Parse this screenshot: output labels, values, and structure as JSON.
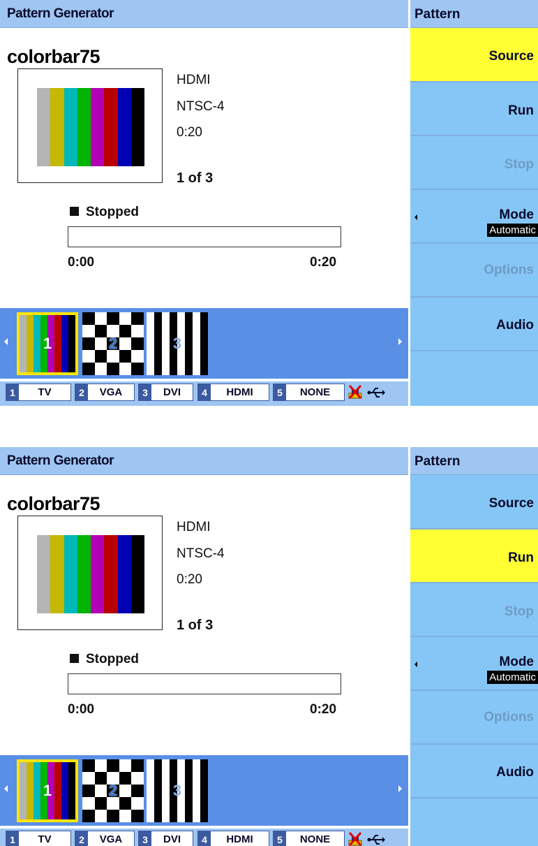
{
  "screens": [
    {
      "title": "Pattern Generator",
      "pattern_name": "colorbar75",
      "info": {
        "source": "HDMI",
        "format": "NTSC-4",
        "duration": "0:20",
        "index": "1 of 3"
      },
      "status": "Stopped",
      "progress_fraction": 0,
      "time_start": "0:00",
      "time_end": "0:20",
      "thumbnails": [
        {
          "label": "1"
        },
        {
          "label": "2"
        },
        {
          "label": "3"
        }
      ],
      "inputs": [
        {
          "num": "1",
          "label": "TV"
        },
        {
          "num": "2",
          "label": "VGA"
        },
        {
          "num": "3",
          "label": "DVI"
        },
        {
          "num": "4",
          "label": "HDMI"
        },
        {
          "num": "5",
          "label": "NONE"
        }
      ],
      "softkeys": {
        "header": "Pattern",
        "source": "Source",
        "run": "Run",
        "stop": "Stop",
        "mode": "Mode",
        "mode_value": "Automatic",
        "options": "Options",
        "audio": "Audio"
      },
      "active_softkey": "source"
    },
    {
      "title": "Pattern Generator",
      "pattern_name": "colorbar75",
      "info": {
        "source": "HDMI",
        "format": "NTSC-4",
        "duration": "0:20",
        "index": "1 of 3"
      },
      "status": "Stopped",
      "progress_fraction": 0,
      "time_start": "0:00",
      "time_end": "0:20",
      "thumbnails": [
        {
          "label": "1"
        },
        {
          "label": "2"
        },
        {
          "label": "3"
        }
      ],
      "inputs": [
        {
          "num": "1",
          "label": "TV"
        },
        {
          "num": "2",
          "label": "VGA"
        },
        {
          "num": "3",
          "label": "DVI"
        },
        {
          "num": "4",
          "label": "HDMI"
        },
        {
          "num": "5",
          "label": "NONE"
        }
      ],
      "softkeys": {
        "header": "Pattern",
        "source": "Source",
        "run": "Run",
        "stop": "Stop",
        "mode": "Mode",
        "mode_value": "Automatic",
        "options": "Options",
        "audio": "Audio"
      },
      "active_softkey": "run"
    }
  ],
  "colorbar_colors": [
    "#b4b4b4",
    "#c4b800",
    "#00b8b8",
    "#00b400",
    "#b400b4",
    "#b80000",
    "#0000b4",
    "#000000"
  ],
  "colors": {
    "title_bar": "#9fc6f2",
    "thumb_strip": "#5a8fe6",
    "softkey_bg": "#86c6f7",
    "softkey_active": "#ffff33",
    "selection_border": "#ffe600"
  },
  "icons": {
    "network": "network-disconnected-icon",
    "usb": "usb-icon"
  }
}
